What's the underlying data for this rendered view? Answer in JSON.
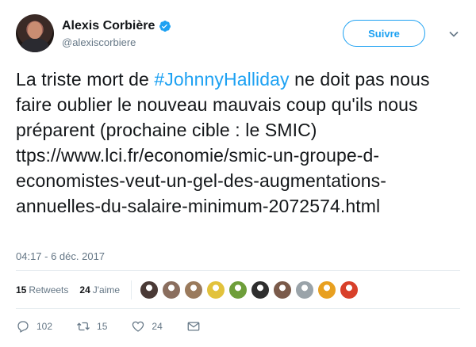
{
  "user": {
    "display_name": "Alexis Corbière",
    "handle": "@alexiscorbiere"
  },
  "follow_label": "Suivre",
  "tweet": {
    "text_before": "La triste mort de ",
    "hashtag": "#JohnnyHalliday",
    "text_after": "  ne doit pas nous faire oublier le nouveau mauvais coup qu'ils nous préparent (prochaine cible : le SMIC) ttps://www.lci.fr/economie/smic-un-groupe-d-economistes-veut-un-gel-des-augmentations-annuelles-du-salaire-minimum-2072574.html",
    "timestamp": "04:17 - 6 déc. 2017"
  },
  "stats": {
    "retweets_count": "15",
    "retweets_label": "Retweets",
    "likes_count": "24",
    "likes_label": "J'aime"
  },
  "liker_avatars": [
    {
      "icon": "avatar-1",
      "color": "#4a3a36"
    },
    {
      "icon": "avatar-2",
      "color": "#8a6e5e"
    },
    {
      "icon": "avatar-3",
      "color": "#9a7a5c"
    },
    {
      "icon": "avatar-4",
      "color": "#e2c23c"
    },
    {
      "icon": "avatar-5",
      "color": "#6e9e3a"
    },
    {
      "icon": "avatar-6",
      "color": "#2e2e2e"
    },
    {
      "icon": "avatar-7",
      "color": "#7a5a4a"
    },
    {
      "icon": "avatar-8",
      "color": "#9aa3a9"
    },
    {
      "icon": "avatar-9",
      "color": "#e8a020"
    },
    {
      "icon": "avatar-10",
      "color": "#d8402a"
    }
  ],
  "actions": {
    "replies_count": "102",
    "retweets_count": "15",
    "likes_count": "24"
  },
  "colors": {
    "accent": "#1da1f2",
    "muted": "#657786",
    "text": "#14171a"
  }
}
